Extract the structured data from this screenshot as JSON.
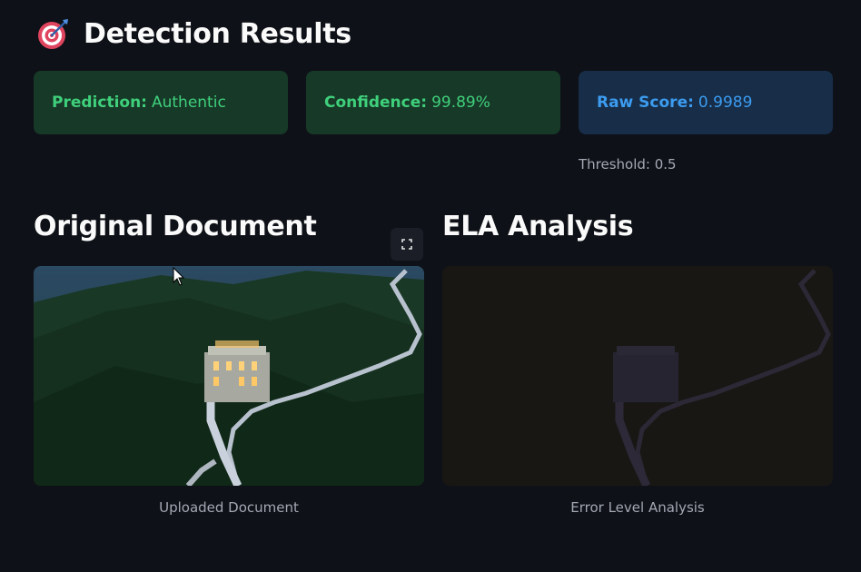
{
  "header": {
    "title": "Detection Results",
    "icon": "target-dart-icon"
  },
  "metrics": {
    "prediction": {
      "label": "Prediction:",
      "value": "Authentic"
    },
    "confidence": {
      "label": "Confidence:",
      "value": "99.89%"
    },
    "raw_score": {
      "label": "Raw Score:",
      "value": "0.9989"
    },
    "threshold": "Threshold: 0.5"
  },
  "sections": {
    "original": {
      "title": "Original Document",
      "caption": "Uploaded Document"
    },
    "ela": {
      "title": "ELA Analysis",
      "caption": "Error Level Analysis"
    }
  },
  "colors": {
    "background": "#0e1117",
    "success_bg": "#173928",
    "success_text": "#3fd07b",
    "info_bg": "#172d48",
    "info_text": "#3c9cf0"
  }
}
